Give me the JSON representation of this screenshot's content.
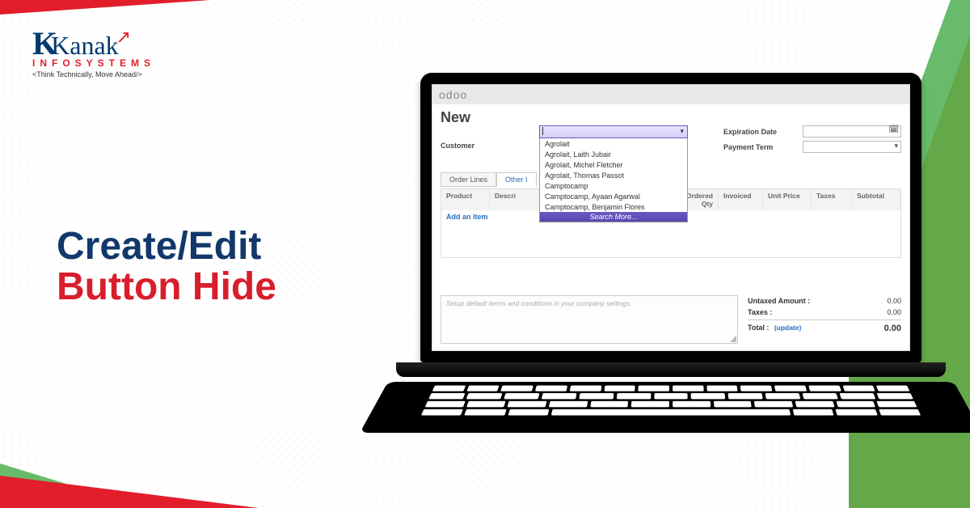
{
  "brand": {
    "name_main": "Kanak",
    "name_sub": "INFOSYSTEMS",
    "tagline": "<Think Technically, Move Ahead/>"
  },
  "headline": {
    "line1": "Create/Edit",
    "line2": "Button Hide"
  },
  "odoo": {
    "logo": "odoo",
    "title": "New",
    "customer_label": "Customer",
    "expiration_label": "Expiration Date",
    "payment_label": "Payment Term",
    "dropdown": {
      "options": [
        "Agrolait",
        "Agrolait, Laith Jubair",
        "Agrolait, Michel Fletcher",
        "Agrolait, Thomas Passot",
        "Camptocamp",
        "Camptocamp, Ayaan Agarwal",
        "Camptocamp, Benjamin Flores"
      ],
      "more": "Search More..."
    },
    "tabs": {
      "order_lines": "Order Lines",
      "other": "Other I"
    },
    "table": {
      "product": "Product",
      "description": "Descri",
      "ordered": "Ordered Qty",
      "invoiced": "Invoiced",
      "unit_price": "Unit Price",
      "taxes": "Taxes",
      "subtotal": "Subtotal",
      "add_item": "Add an item"
    },
    "footer": {
      "placeholder": "Setup default terms and conditions in your company settings.",
      "untaxed_label": "Untaxed Amount :",
      "taxes_label": "Taxes :",
      "total_label": "Total :",
      "update": "(update)",
      "untaxed_val": "0.00",
      "taxes_val": "0.00",
      "total_val": "0.00"
    }
  }
}
